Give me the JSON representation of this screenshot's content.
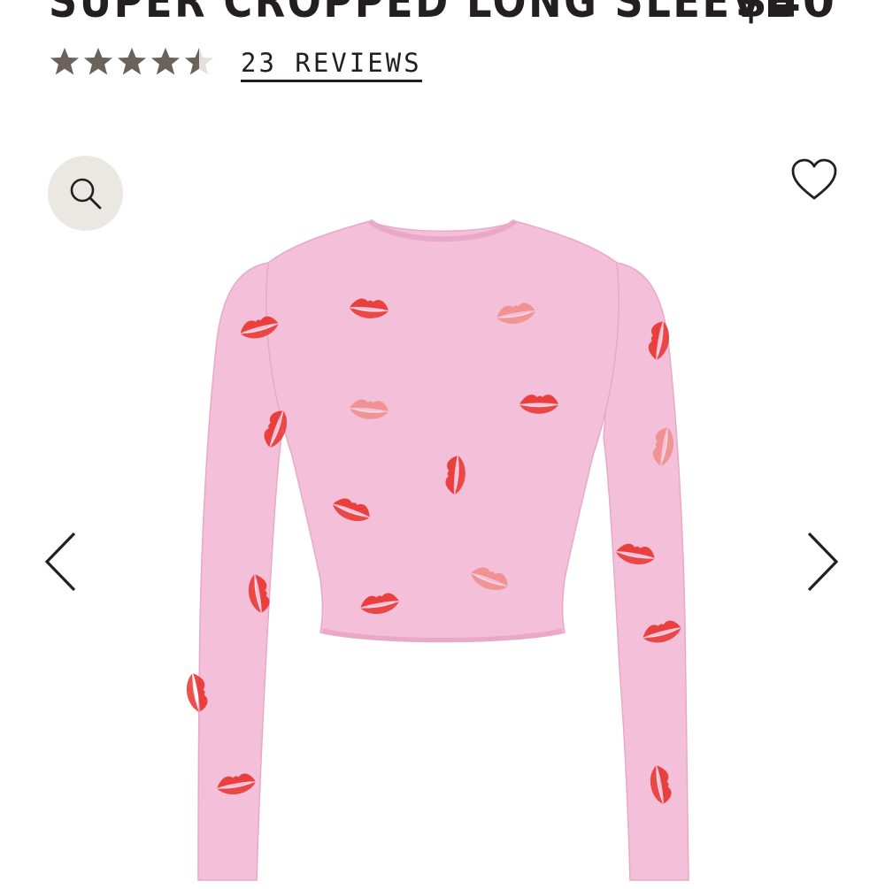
{
  "product": {
    "title": "SUPER CROPPED LONG SLEEVE",
    "price": "$40",
    "rating": 4.5,
    "reviews_label": "23 REVIEWS",
    "image_alt": "Pink cropped long sleeve top with red lip print",
    "colors": {
      "fabric": "#f4bfd8",
      "fabric_shade": "#e9a9c6",
      "lip_red": "#e8322e",
      "lip_pink": "#ef8d8a"
    }
  },
  "icons": {
    "zoom": "magnifier-icon",
    "wishlist": "heart-icon",
    "prev": "chevron-left-icon",
    "next": "chevron-right-icon",
    "star": "star-icon"
  }
}
